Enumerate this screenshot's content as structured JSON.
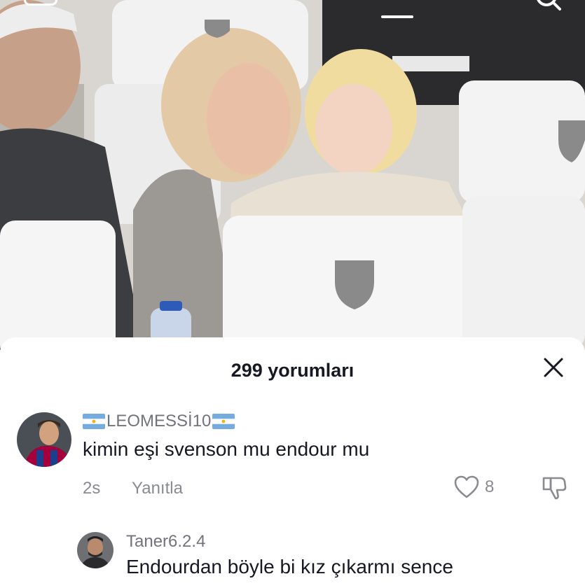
{
  "colors": {
    "text_primary": "#161823",
    "text_secondary": "#73747b",
    "meta": "#8a8b91",
    "sheet_bg": "#ffffff"
  },
  "video": {
    "icons": [
      "back-icon",
      "progress-indicator",
      "search-icon"
    ]
  },
  "comments_sheet": {
    "title": "299 yorumları",
    "close_icon": "close-icon",
    "comments": [
      {
        "username": "LEOMESSİ10",
        "flags": [
          "argentina-flag-icon",
          "argentina-flag-icon"
        ],
        "text": "kimin eşi svenson mu endour mu",
        "time": "2s",
        "reply_label": "Yanıtla",
        "likes": "8",
        "like_icon": "heart-icon",
        "dislike_icon": "dislike-icon"
      },
      {
        "username": "Taner6.2.4",
        "text": "Endourdan böyle bi kız çıkarmı sence"
      }
    ]
  }
}
